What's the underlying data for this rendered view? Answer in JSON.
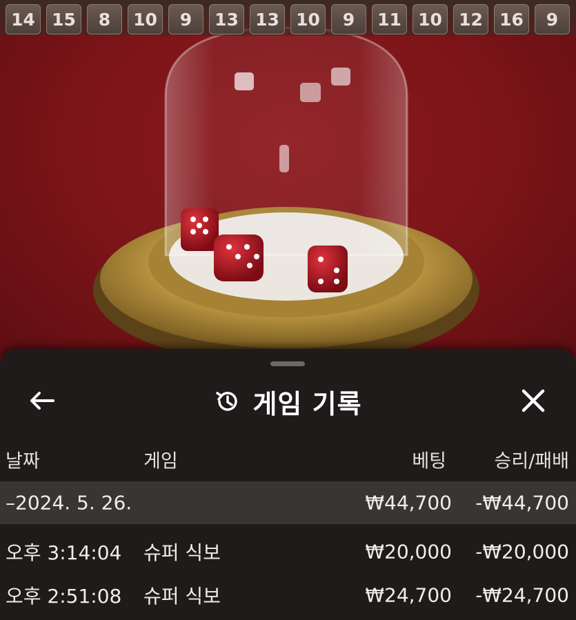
{
  "history": [
    14,
    15,
    8,
    10,
    9,
    13,
    13,
    10,
    9,
    11,
    10,
    12,
    16,
    9
  ],
  "sheet": {
    "title": "게임 기록",
    "columns": {
      "date": "날짜",
      "game": "게임",
      "bet": "베팅",
      "win_loss": "승리/패배"
    },
    "date_group": {
      "date": "–2024. 5. 26.",
      "bet": "₩44,700",
      "win_loss": "-₩44,700"
    },
    "rows": [
      {
        "time": "오후 3:14:04",
        "game": "슈퍼 식보",
        "bet": "₩20,000",
        "win_loss": "-₩20,000"
      },
      {
        "time": "오후 2:51:08",
        "game": "슈퍼 식보",
        "bet": "₩24,700",
        "win_loss": "-₩24,700"
      }
    ]
  },
  "colors": {
    "table_felt": "#7a1418",
    "sheet_bg": "#1f1b1b",
    "date_row_bg": "#3a3535"
  }
}
